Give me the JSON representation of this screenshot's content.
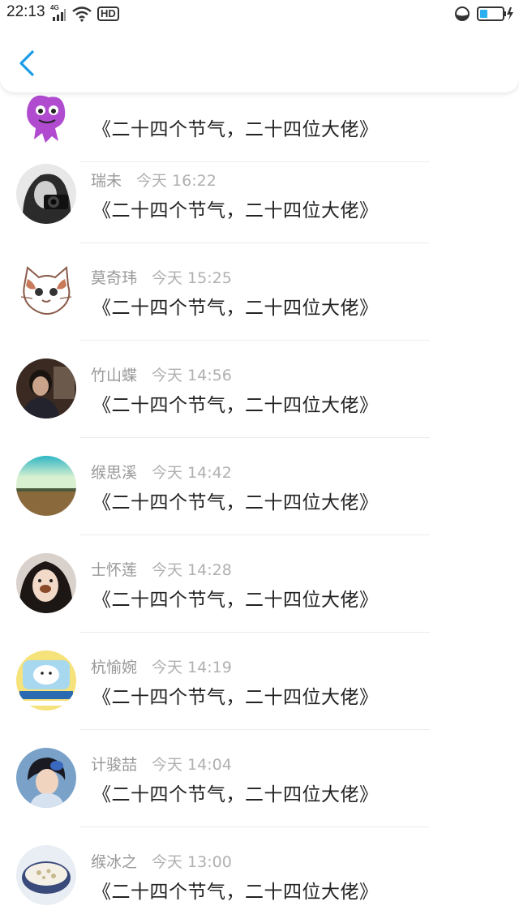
{
  "status_bar": {
    "time": "22:13",
    "network": "4G",
    "hd": "HD"
  },
  "nav": {
    "back_icon": "chevron-left-icon",
    "accent_color": "#1a9be8"
  },
  "comments": [
    {
      "username": "",
      "timestamp": "",
      "content": "《二十四个节气，二十四位大佬》"
    },
    {
      "username": "瑞未",
      "timestamp": "今天 16:22",
      "content": "《二十四个节气，二十四位大佬》"
    },
    {
      "username": "莫奇玮",
      "timestamp": "今天 15:25",
      "content": "《二十四个节气，二十四位大佬》"
    },
    {
      "username": "竹山蝶",
      "timestamp": "今天 14:56",
      "content": "《二十四个节气，二十四位大佬》"
    },
    {
      "username": "缑思溪",
      "timestamp": "今天 14:42",
      "content": "《二十四个节气，二十四位大佬》"
    },
    {
      "username": "士怀莲",
      "timestamp": "今天 14:28",
      "content": "《二十四个节气，二十四位大佬》"
    },
    {
      "username": "杭愉婉",
      "timestamp": "今天 14:19",
      "content": "《二十四个节气，二十四位大佬》"
    },
    {
      "username": "计骏喆",
      "timestamp": "今天 14:04",
      "content": "《二十四个节气，二十四位大佬》"
    },
    {
      "username": "缑冰之",
      "timestamp": "今天 13:00",
      "content": "《二十四个节气，二十四位大佬》"
    }
  ]
}
